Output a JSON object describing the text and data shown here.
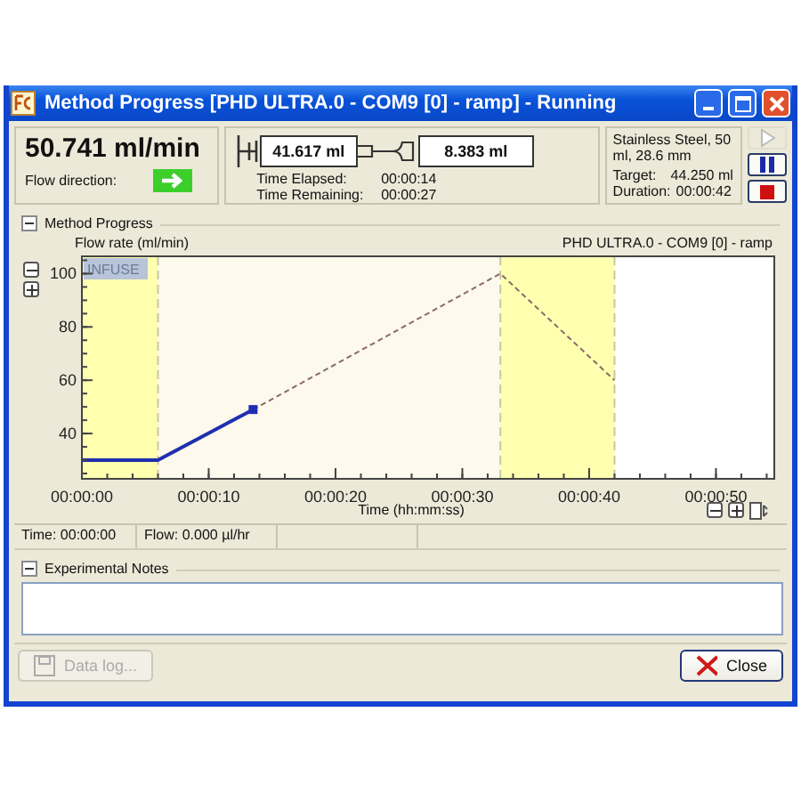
{
  "window": {
    "title": "Method Progress [PHD ULTRA.0 - COM9 [0] - ramp] - Running"
  },
  "status": {
    "flow_rate": "50.741 ml/min",
    "flow_direction_label": "Flow direction:"
  },
  "syringe": {
    "syringe_volume": "41.617 ml",
    "delivered_volume": "8.383 ml",
    "time_elapsed_label": "Time Elapsed:",
    "time_elapsed": "00:00:14",
    "time_remaining_label": "Time Remaining:",
    "time_remaining": "00:00:27"
  },
  "syringe_info": {
    "description": "Stainless Steel, 50 ml, 28.6 mm",
    "target_label": "Target:",
    "target": "44.250 ml",
    "duration_label": "Duration:",
    "duration": "00:00:42"
  },
  "controls": [
    {
      "kind": "run",
      "disabled": true
    },
    {
      "kind": "pause",
      "disabled": false
    },
    {
      "kind": "stop",
      "disabled": false
    }
  ],
  "method_progress": {
    "title": "Method Progress",
    "expanded": true,
    "chart_title": "PHD ULTRA.0 - COM9 [0] - ramp",
    "chart_data": {
      "type": "line",
      "xlabel": "Time (hh:mm:ss)",
      "ylabel": "Flow rate (ml/min)",
      "x": [
        0,
        6,
        13.5,
        33,
        42
      ],
      "series": [
        {
          "color": "#1f2fb0",
          "line_style": "solid",
          "values": [
            30,
            30,
            49,
            null,
            null
          ]
        },
        {
          "color": "#8a6a6a",
          "line_style": "dashed",
          "values": [
            null,
            null,
            49,
            100,
            60
          ]
        }
      ],
      "xlim": [
        0,
        54.6
      ],
      "ylim": [
        23,
        106.5
      ],
      "xticks": [
        {
          "value": 0,
          "label": "00:00:00"
        },
        {
          "value": 10,
          "label": "00:00:10"
        },
        {
          "value": 20,
          "label": "00:00:20"
        },
        {
          "value": 30,
          "label": "00:00:30"
        },
        {
          "value": 40,
          "label": "00:00:40"
        },
        {
          "value": 50,
          "label": "00:00:50"
        }
      ],
      "yticks": [
        40,
        60,
        80,
        100
      ],
      "bands": [
        {
          "axis": "x",
          "from": 0,
          "to": 42,
          "color": "#fdf9ec"
        },
        {
          "axis": "x",
          "from": 0,
          "to": 6,
          "color": "#ffffb0",
          "label": "INFUSE"
        },
        {
          "axis": "x",
          "from": 33,
          "to": 42,
          "color": "#ffffb0"
        }
      ]
    },
    "status_bar": [
      "Time: 00:00:00",
      "Flow: 0.000 µl/hr"
    ]
  },
  "notes": {
    "title": "Experimental Notes",
    "expanded": true
  },
  "buttons": [
    {
      "label": "Data log...",
      "kind": "data_log",
      "disabled": true
    },
    {
      "label": "Close",
      "kind": "close",
      "disabled": false
    }
  ]
}
